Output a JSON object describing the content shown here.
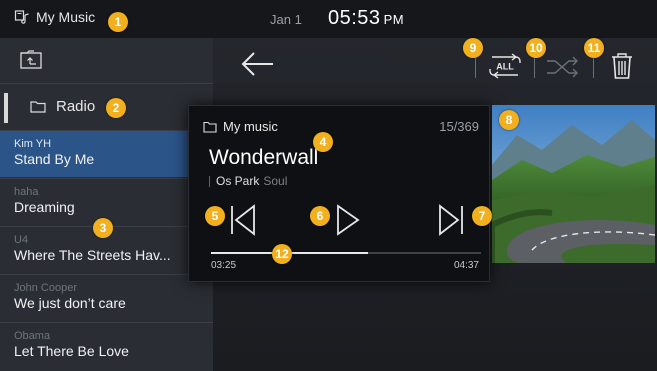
{
  "status": {
    "source": "My Music",
    "date": "Jan 1",
    "time": "05:53",
    "ampm": "PM"
  },
  "sidebar": {
    "radio_label": "Radio",
    "tracks": [
      {
        "artist": "Kim YH",
        "title": "Stand By Me",
        "selected": true
      },
      {
        "artist": "haha",
        "title": "Dreaming"
      },
      {
        "artist": "U4",
        "title": "Where The Streets Hav..."
      },
      {
        "artist": "John Cooper",
        "title": "We just don’t care"
      },
      {
        "artist": "Obama",
        "title": "Let There Be Love"
      }
    ]
  },
  "player": {
    "folder": "My music",
    "count": "15/369",
    "song": "Wonderwall",
    "artist": "Os Park",
    "genre": "Soul",
    "time_current": "03:25",
    "time_total": "04:37",
    "progress": 0.58
  },
  "toolbar": {
    "repeat_label": "ALL"
  },
  "badges": [
    "1",
    "2",
    "3",
    "4",
    "5",
    "6",
    "7",
    "8",
    "9",
    "10",
    "11",
    "12"
  ],
  "colors": {
    "badge": "#f2b01e",
    "selected_row": "#2b5489",
    "background": "#1b1e23"
  }
}
